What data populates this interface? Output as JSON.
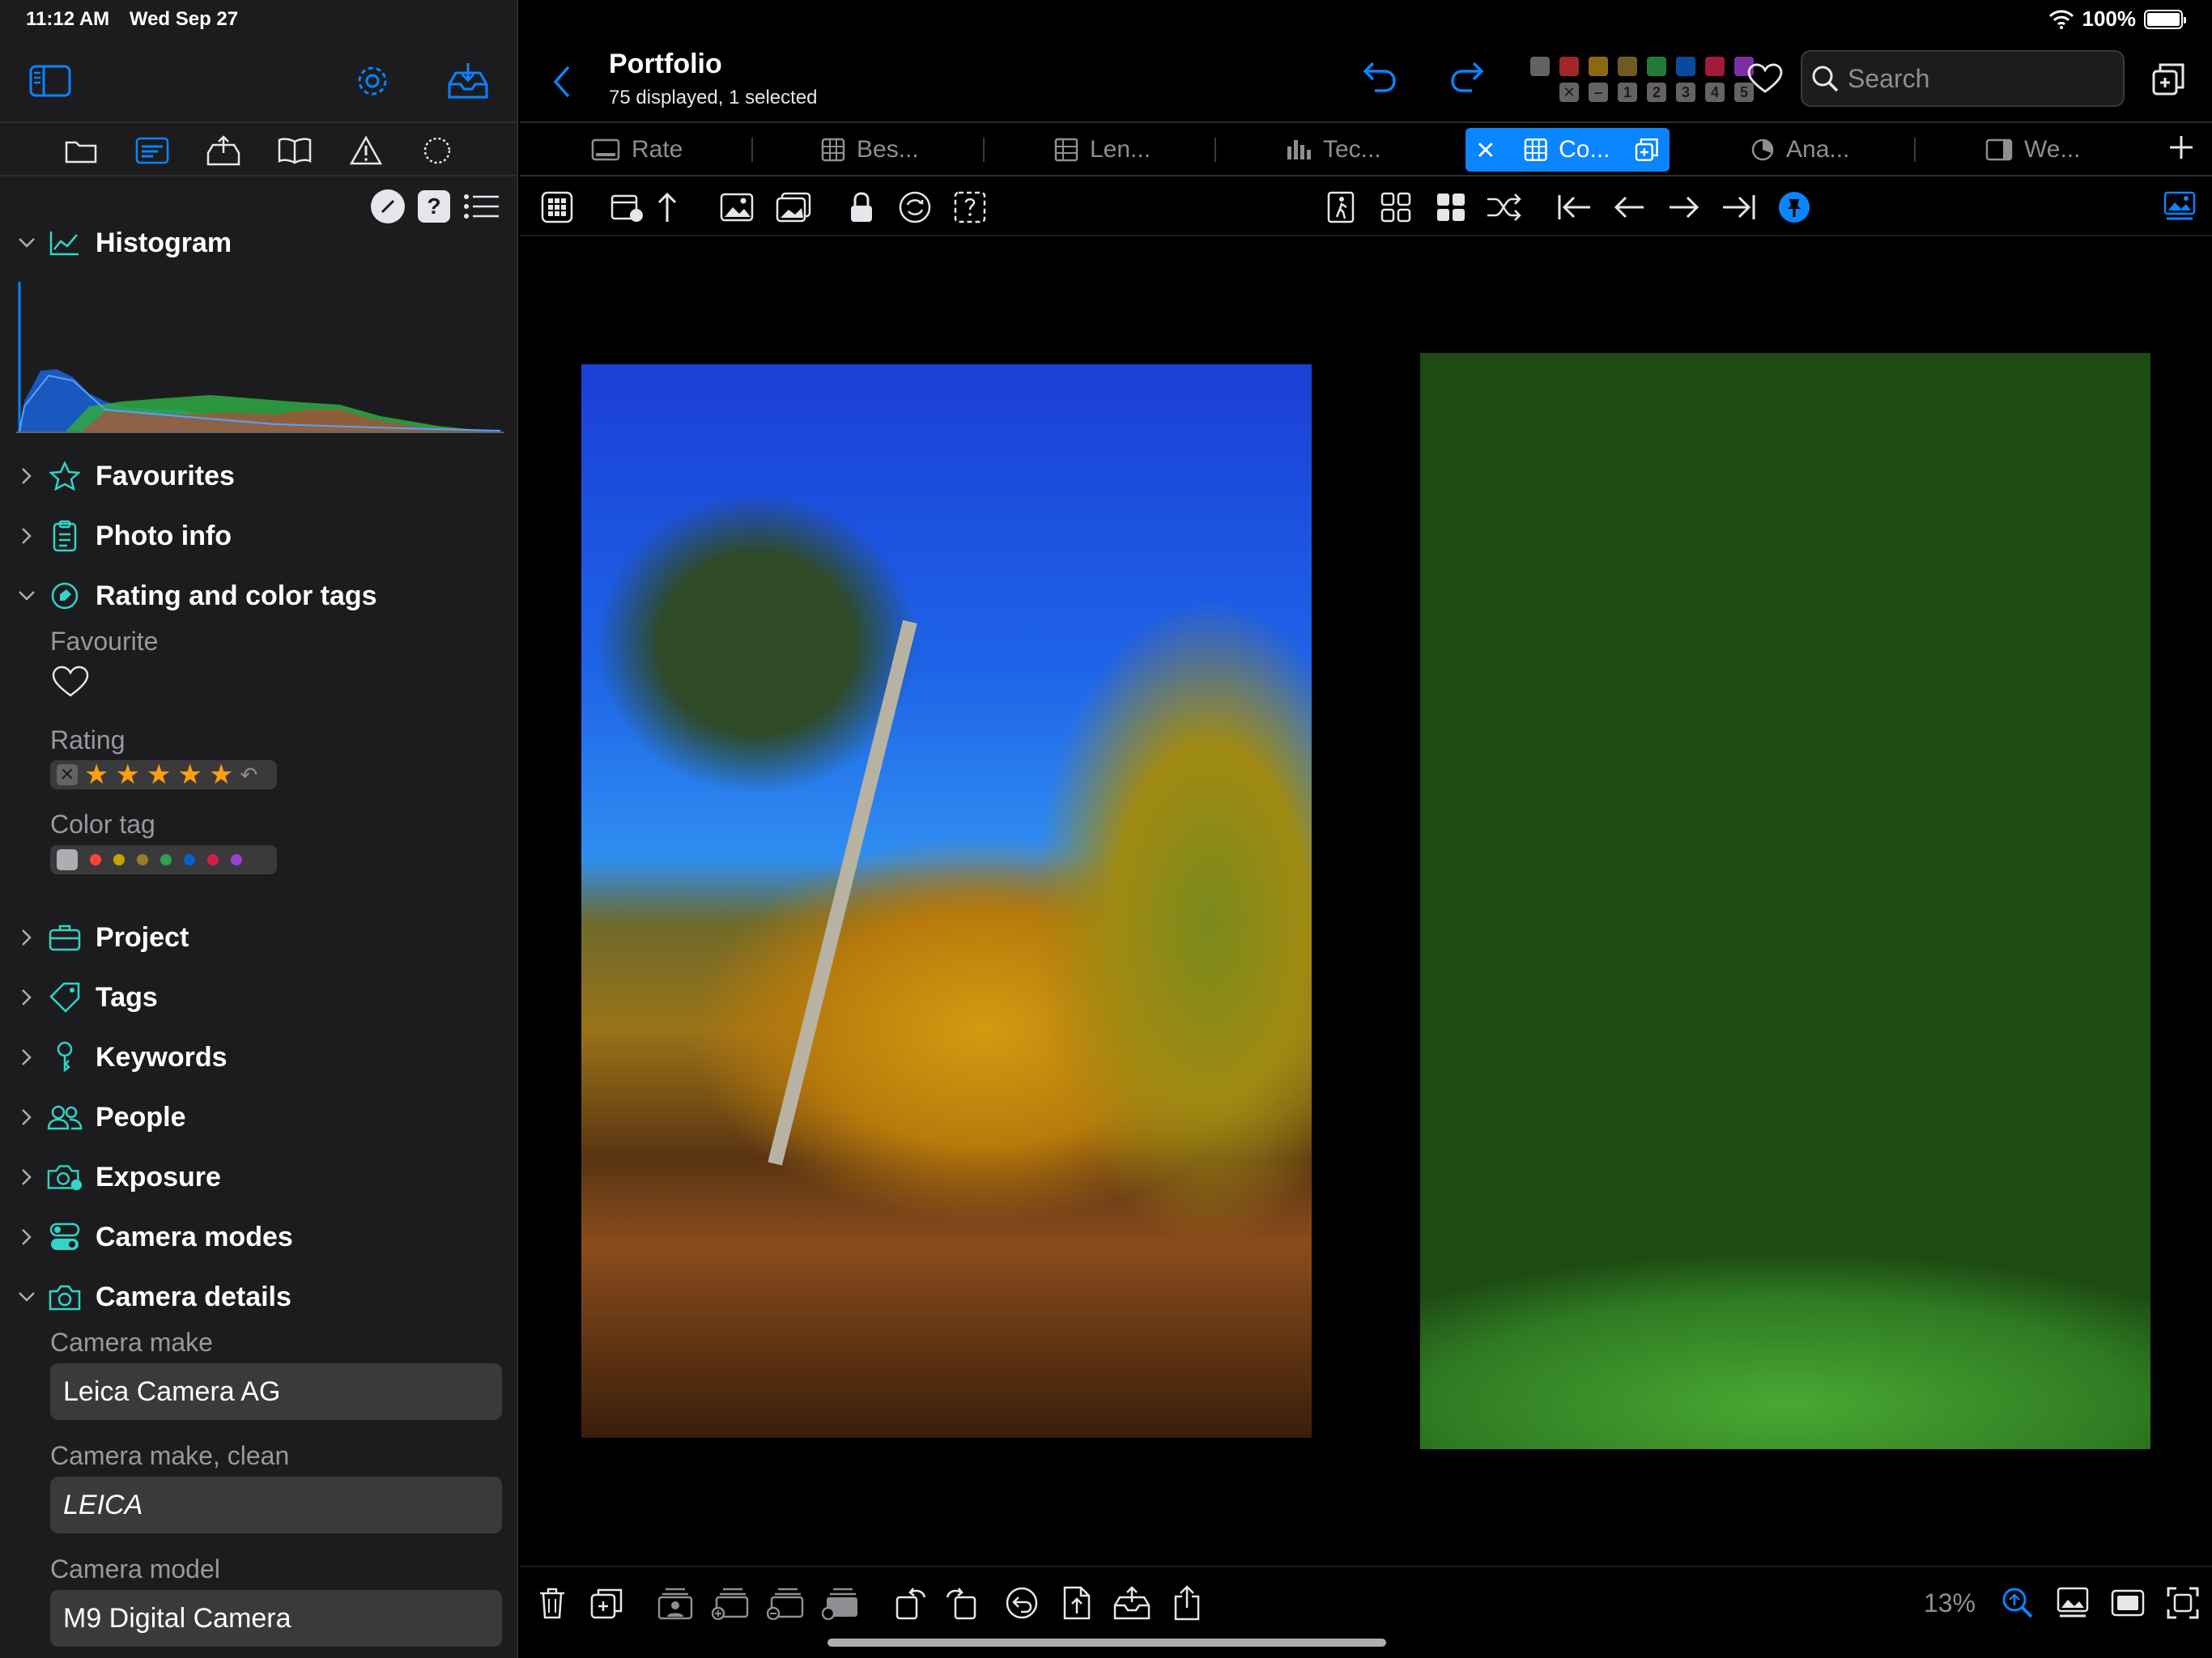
{
  "status": {
    "time": "11:12 AM",
    "date": "Wed Sep 27",
    "battery": "100%"
  },
  "header": {
    "title": "Portfolio",
    "subtitle": "75 displayed, 1 selected",
    "search_placeholder": "Search"
  },
  "color_tag_filter": {
    "colors": [
      "#636366",
      "#ff453a",
      "#c7a300",
      "#9a7b2c",
      "#30a14e",
      "#0a60c8",
      "#d0204a",
      "#9b3fcf"
    ],
    "labels": [
      "✕",
      "–",
      "1",
      "2",
      "3",
      "4",
      "5"
    ]
  },
  "tabs": [
    {
      "label": "Rate",
      "icon": "rectangle-icon",
      "active": false
    },
    {
      "label": "Bes...",
      "icon": "grid-icon",
      "active": false
    },
    {
      "label": "Len...",
      "icon": "table-icon",
      "active": false
    },
    {
      "label": "Tec...",
      "icon": "bar-chart-icon",
      "active": false
    },
    {
      "label": "Co...",
      "icon": "grid-icon",
      "active": true
    },
    {
      "label": "Ana...",
      "icon": "pie-icon",
      "active": false
    },
    {
      "label": "We...",
      "icon": "sidebar-icon",
      "active": false
    }
  ],
  "sidebar": {
    "sections": [
      {
        "label": "Histogram",
        "icon": "chart-line-icon",
        "expanded": true
      },
      {
        "label": "Favourites",
        "icon": "star-icon",
        "expanded": false
      },
      {
        "label": "Photo info",
        "icon": "clipboard-icon",
        "expanded": false
      },
      {
        "label": "Rating and color tags",
        "icon": "tag-circle-icon",
        "expanded": true
      },
      {
        "label": "Project",
        "icon": "briefcase-icon",
        "expanded": false
      },
      {
        "label": "Tags",
        "icon": "tag-icon",
        "expanded": false
      },
      {
        "label": "Keywords",
        "icon": "key-icon",
        "expanded": false
      },
      {
        "label": "People",
        "icon": "people-icon",
        "expanded": false
      },
      {
        "label": "Exposure",
        "icon": "camera-exposure-icon",
        "expanded": false
      },
      {
        "label": "Camera modes",
        "icon": "toggles-icon",
        "expanded": false
      },
      {
        "label": "Camera details",
        "icon": "camera-icon",
        "expanded": true
      }
    ],
    "rating": {
      "favourite_label": "Favourite",
      "rating_label": "Rating",
      "rating_value": 5,
      "color_tag_label": "Color tag"
    },
    "camera_details": {
      "make_label": "Camera make",
      "make_value": "Leica Camera AG",
      "make_clean_label": "Camera make, clean",
      "make_clean_value": "LEICA",
      "model_label": "Camera model",
      "model_value": "M9 Digital Camera"
    }
  },
  "viewer": {
    "zoom": "13%"
  }
}
